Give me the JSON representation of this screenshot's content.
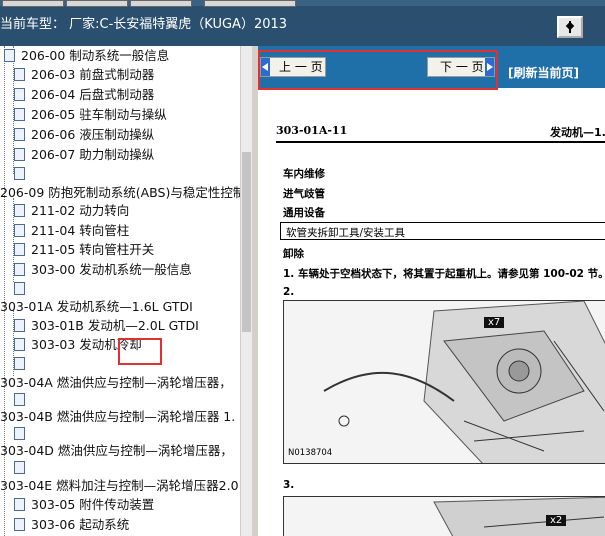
{
  "header": {
    "vehicle_label": "当前车型：  厂家:C-长安福特翼虎（KUGA）2013"
  },
  "tree": {
    "items": [
      {
        "label": "206-00 制动系统一般信息",
        "level": 2,
        "icon": "document-icon"
      },
      {
        "label": "206-03 前盘式制动器",
        "level": 2,
        "icon": "document-icon"
      },
      {
        "label": "206-04 后盘式制动器",
        "level": 2,
        "icon": "document-icon"
      },
      {
        "label": "206-05 驻车制动与操纵",
        "level": 2,
        "icon": "document-icon"
      },
      {
        "label": "206-06 液压制动操纵",
        "level": 2,
        "icon": "document-icon"
      },
      {
        "label": "206-07 助力制动操纵",
        "level": 2,
        "icon": "document-icon"
      },
      {
        "label": "",
        "level": 2,
        "icon": "document-icon"
      },
      {
        "label": "206-09 防抱死制动系统(ABS)与稳定性控制",
        "level": 1,
        "icon": ""
      },
      {
        "label": "211-02 动力转向",
        "level": 2,
        "icon": "document-icon"
      },
      {
        "label": "211-04 转向管柱",
        "level": 2,
        "icon": "document-icon"
      },
      {
        "label": "211-05 转向管柱开关",
        "level": 2,
        "icon": "document-icon"
      },
      {
        "label": "303-00 发动机系统一般信息",
        "level": 2,
        "icon": "document-icon"
      },
      {
        "label": "",
        "level": 2,
        "icon": "document-icon"
      },
      {
        "label": "303-01A 发动机系统—1.6L GTDI",
        "level": 1,
        "icon": ""
      },
      {
        "label": "303-01B 发动机—2.0L GTDI",
        "level": 2,
        "icon": "document-icon"
      },
      {
        "label": "303-03 发动机冷却",
        "level": 2,
        "icon": "document-icon"
      },
      {
        "label": "",
        "level": 2,
        "icon": "document-icon"
      },
      {
        "label": "303-04A 燃油供应与控制—涡轮增压器，",
        "level": 1,
        "icon": ""
      },
      {
        "label": "",
        "level": 2,
        "icon": "document-icon"
      },
      {
        "label": "303-04B 燃油供应与控制—涡轮增压器 1.",
        "level": 1,
        "icon": ""
      },
      {
        "label": "",
        "level": 2,
        "icon": "document-icon"
      },
      {
        "label": "303-04D 燃油供应与控制—涡轮增压器，",
        "level": 1,
        "icon": ""
      },
      {
        "label": "",
        "level": 2,
        "icon": "document-icon"
      },
      {
        "label": "303-04E 燃料加注与控制—涡轮增压器2.0",
        "level": 1,
        "icon": ""
      },
      {
        "label": "303-05 附件传动装置",
        "level": 2,
        "icon": "document-icon"
      },
      {
        "label": "303-06 起动系统",
        "level": 2,
        "icon": "document-icon"
      }
    ]
  },
  "toolbar": {
    "prev_label": "上 一 页",
    "next_label": "下 一 页",
    "refresh_label": "[刷新当前页]"
  },
  "document": {
    "code": "303-01A-11",
    "title": "发动机—1.",
    "section_vehicle": "车内维修",
    "section_part": "进气歧管",
    "general_equipment": "通用设备",
    "tool": "软管夹拆卸工具/安装工具",
    "removal": "卸除",
    "step1": "1.  车辆处于空档状态下，将其置于起重机上。请参见第 100-02 节。",
    "step2": "2.",
    "step3": "3.",
    "figure1_id": "N0138704",
    "callout1": "x7",
    "callout2": "x2"
  },
  "colors": {
    "toolbar_blue": "#1f6fa8",
    "header_blue": "#2b4f6e",
    "highlight_red": "#e23030"
  }
}
